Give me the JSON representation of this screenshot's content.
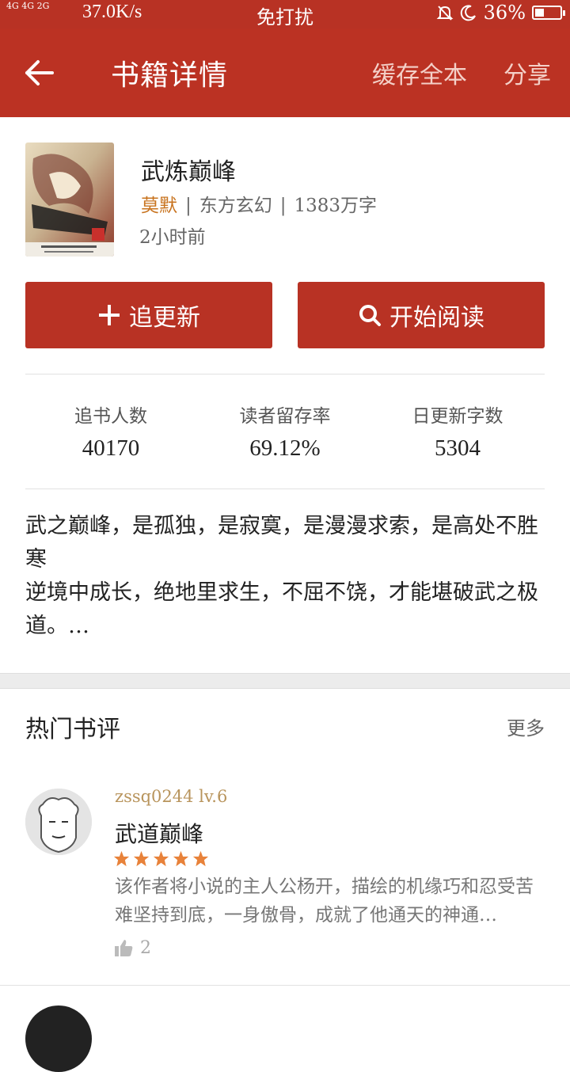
{
  "status_bar": {
    "network_left": "4G 4G 2G",
    "speed": "37.0K/s",
    "mode": "免打扰",
    "battery": "36%",
    "battery_level": 0.36
  },
  "app_bar": {
    "title": "书籍详情",
    "cache_label": "缓存全本",
    "share_label": "分享"
  },
  "book": {
    "name": "武炼巅峰",
    "author": "莫默",
    "category": "东方玄幻",
    "words": "1383万字",
    "updated": "2小时前"
  },
  "actions": {
    "follow_label": "追更新",
    "read_label": "开始阅读"
  },
  "stats": [
    {
      "label": "追书人数",
      "value": "40170"
    },
    {
      "label": "读者留存率",
      "value": "69.12%"
    },
    {
      "label": "日更新字数",
      "value": "5304"
    }
  ],
  "description": "武之巅峰，是孤独，是寂寞，是漫漫求索，是高处不胜寒\n逆境中成长，绝地里求生，不屈不饶，才能堪破武之极道。…",
  "reviews_section": {
    "title": "热门书评",
    "more_label": "更多"
  },
  "review": {
    "username": "zssq0244  lv.6",
    "title": "武道巅峰",
    "rating": 5,
    "text": "该作者将小说的主人公杨开，描绘的机缘巧和忍受苦难坚持到底，一身傲骨，成就了他通天的神通…",
    "likes": "2"
  },
  "colors": {
    "primary": "#bb3223",
    "author": "#c8731e",
    "star": "#e8823a"
  }
}
